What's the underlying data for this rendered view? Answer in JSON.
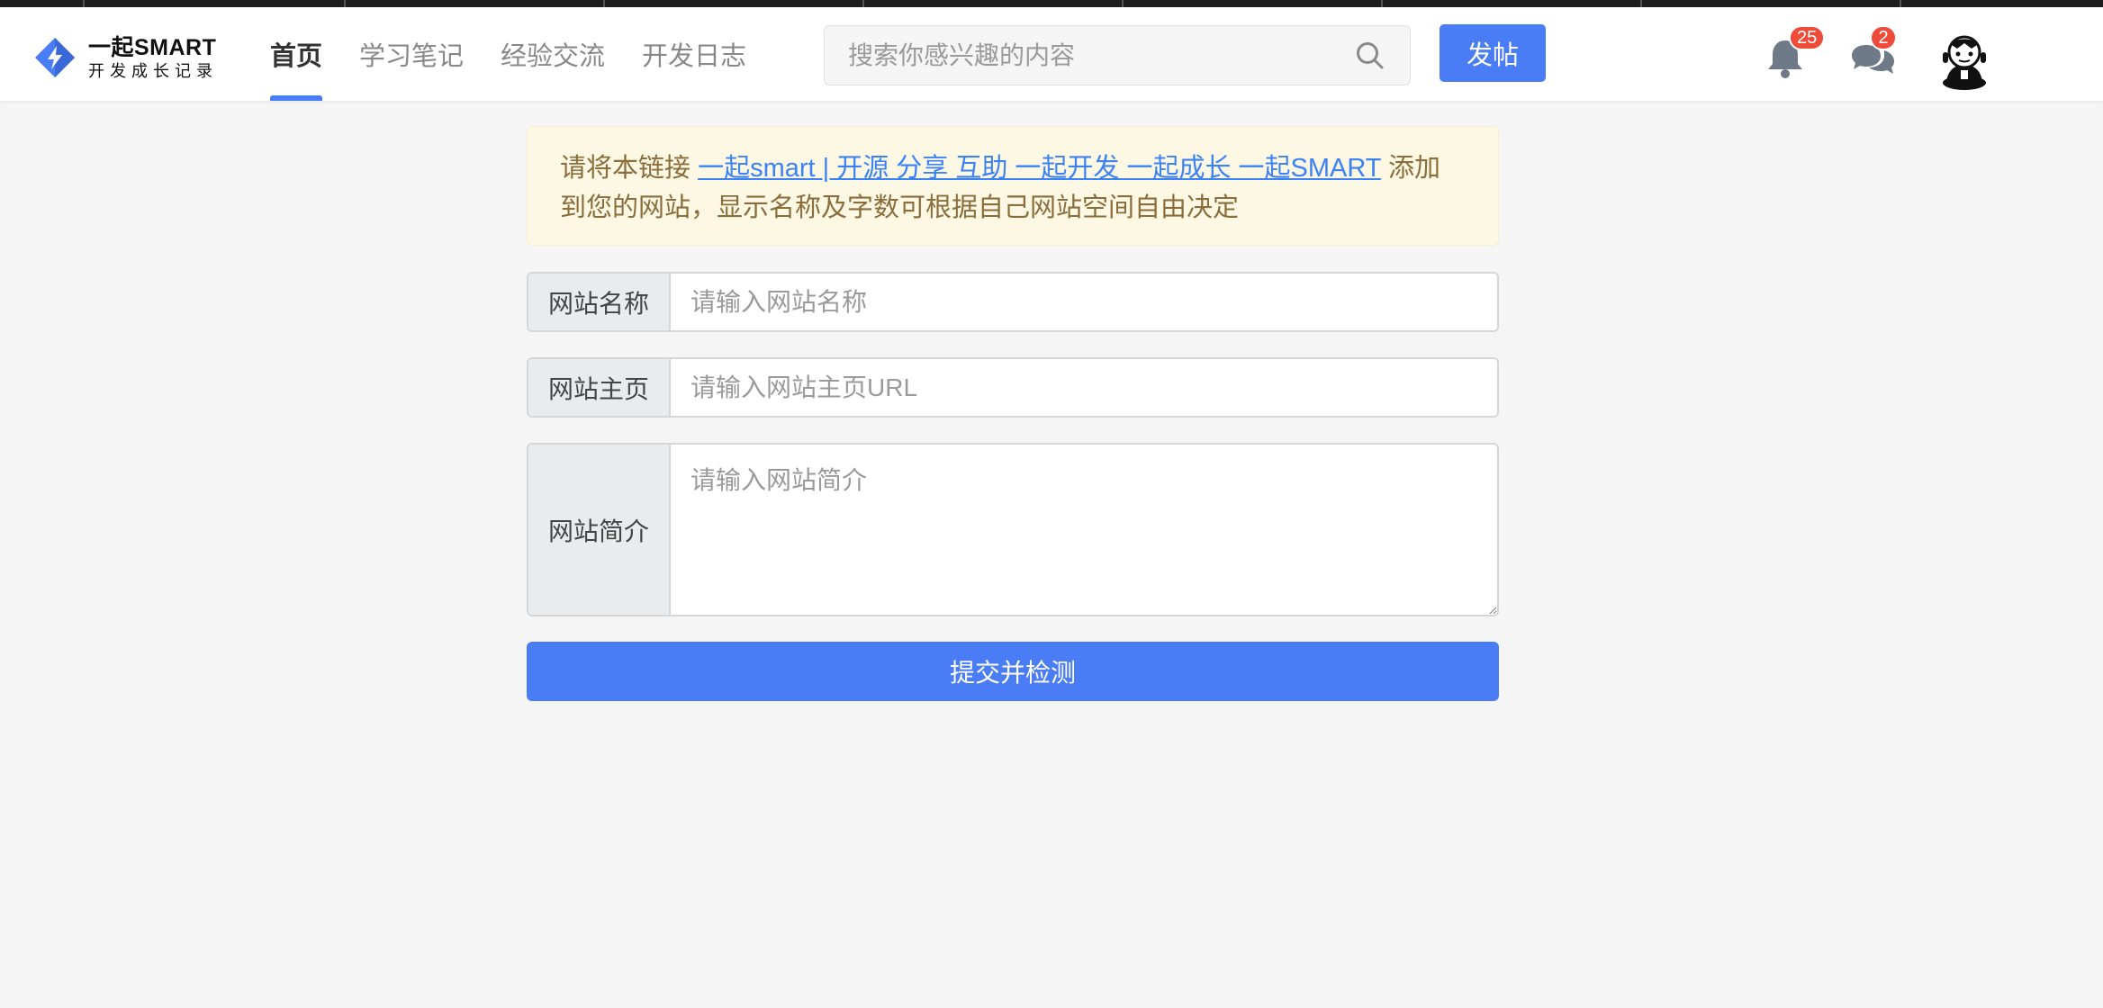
{
  "brand": {
    "title": "一起SMART",
    "subtitle": "开发成长记录",
    "accent": "#4a7cf5"
  },
  "nav": [
    {
      "label": "首页",
      "active": true
    },
    {
      "label": "学习笔记",
      "active": false
    },
    {
      "label": "经验交流",
      "active": false
    },
    {
      "label": "开发日志",
      "active": false
    }
  ],
  "search": {
    "placeholder": "搜索你感兴趣的内容",
    "value": "",
    "icon": "search-icon"
  },
  "header_actions": {
    "post_label": "发帖",
    "notifications_count": "25",
    "messages_count": "2",
    "notification_icon": "bell-icon",
    "message_icon": "chat-bubbles-icon",
    "avatar_icon": "user-avatar"
  },
  "notice": {
    "prefix": "请将本链接 ",
    "link_text": "一起smart | 开源 分享 互助 一起开发 一起成长 一起SMART",
    "suffix": " 添加到您的网站，显示名称及字数可根据自己网站空间自由决定",
    "bg_color": "#fcf8e3",
    "text_color": "#8a6d3b"
  },
  "form": {
    "name_label": "网站名称",
    "name_placeholder": "请输入网站名称",
    "name_value": "",
    "home_label": "网站主页",
    "home_placeholder": "请输入网站主页URL",
    "home_value": "",
    "intro_label": "网站简介",
    "intro_placeholder": "请输入网站简介",
    "intro_value": "",
    "submit_label": "提交并检测"
  }
}
